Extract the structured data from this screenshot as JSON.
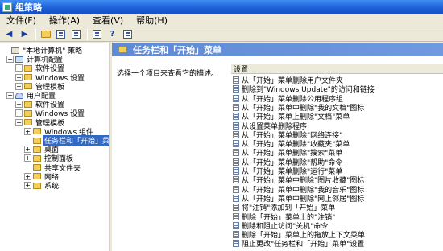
{
  "window": {
    "title": "组策略"
  },
  "menu": [
    "文件(F)",
    "操作(A)",
    "查看(V)",
    "帮助(H)"
  ],
  "toolbar": [
    "back-icon",
    "forward-icon",
    "folder-up-icon",
    "show-tree-icon",
    "properties-icon",
    "refresh-icon",
    "help-icon",
    "view-icon"
  ],
  "tree": [
    {
      "label": "\"本地计算机\" 策略",
      "level": 0,
      "icon": "policy",
      "expander": ""
    },
    {
      "label": "计算机配置",
      "level": 1,
      "icon": "comp",
      "expander": "−"
    },
    {
      "label": "软件设置",
      "level": 2,
      "icon": "folder",
      "expander": "+"
    },
    {
      "label": "Windows 设置",
      "level": 2,
      "icon": "folder",
      "expander": "+"
    },
    {
      "label": "管理模板",
      "level": 2,
      "icon": "folder",
      "expander": "+"
    },
    {
      "label": "用户配置",
      "level": 1,
      "icon": "user",
      "expander": "−"
    },
    {
      "label": "软件设置",
      "level": 2,
      "icon": "folder",
      "expander": "+"
    },
    {
      "label": "Windows 设置",
      "level": 2,
      "icon": "folder",
      "expander": "+"
    },
    {
      "label": "管理模板",
      "level": 2,
      "icon": "folder",
      "expander": "−"
    },
    {
      "label": "Windows 组件",
      "level": 3,
      "icon": "folder",
      "expander": "+"
    },
    {
      "label": "任务栏和「开始」菜",
      "level": 3,
      "icon": "folder",
      "expander": "",
      "selected": true
    },
    {
      "label": "桌面",
      "level": 3,
      "icon": "folder",
      "expander": "+"
    },
    {
      "label": "控制面板",
      "level": 3,
      "icon": "folder",
      "expander": "+"
    },
    {
      "label": "共享文件夹",
      "level": 3,
      "icon": "folder",
      "expander": ""
    },
    {
      "label": "网络",
      "level": 3,
      "icon": "folder",
      "expander": "+"
    },
    {
      "label": "系统",
      "level": 3,
      "icon": "folder",
      "expander": "+"
    }
  ],
  "right": {
    "header": "任务栏和「开始」菜单",
    "description": "选择一个项目来查看它的描述。",
    "column": "设置",
    "items": [
      "从「开始」菜单删除用户文件夹",
      "删除到\"Windows Update\"的访问和链接",
      "从「开始」菜单删除公用程序组",
      "从「开始」菜单中删除\"我的文档\"图标",
      "从「开始」菜单上删除\"文档\"菜单",
      "从设置菜单删除程序",
      "从「开始」菜单删除\"网络连接\"",
      "从「开始」菜单删除\"收藏夹\"菜单",
      "从「开始」菜单删除\"搜索\"菜单",
      "从「开始」菜单删除\"帮助\"命令",
      "从「开始」菜单删除\"运行\"菜单",
      "从「开始」菜单中删除\"图片收藏\"图标",
      "从「开始」菜单中删除\"我的音乐\"图标",
      "从「开始」菜单中删除\"网上邻居\"图标",
      "将\"注销\"添加到「开始」菜单",
      "删除「开始」菜单上的\"注销\"",
      "删除和阻止访问\"关机\"命令",
      "删除「开始」菜单上的拖放上下文菜单",
      "阻止更改\"任务栏和「开始」菜单\"设置"
    ]
  }
}
